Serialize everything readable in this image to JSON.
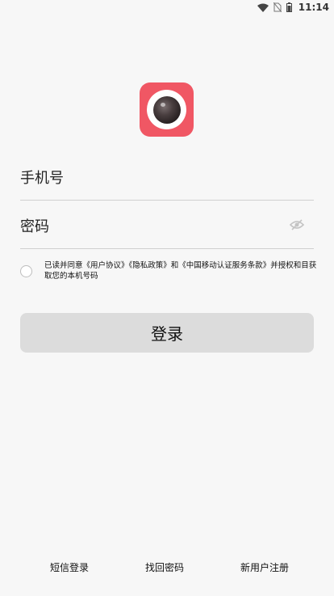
{
  "status_bar": {
    "time": "11:14",
    "icons": [
      "wifi-icon",
      "no-sim-icon",
      "battery-icon"
    ]
  },
  "app_logo": {
    "icon": "camera-lens-icon",
    "color": "#f05764"
  },
  "phone_field": {
    "placeholder": "手机号",
    "value": ""
  },
  "password_field": {
    "placeholder": "密码",
    "value": "",
    "toggle_icon": "eye-hidden-icon"
  },
  "agreement": {
    "checked": false,
    "text": "已读并同意《用户协议》《隐私政策》和《中国移动认证服务条款》并授权和目获取您的本机号码"
  },
  "login_button": {
    "label": "登录",
    "background": "#dcdcdc"
  },
  "bottom_links": {
    "sms_login": "短信登录",
    "forgot_password": "找回密码",
    "register": "新用户注册"
  }
}
